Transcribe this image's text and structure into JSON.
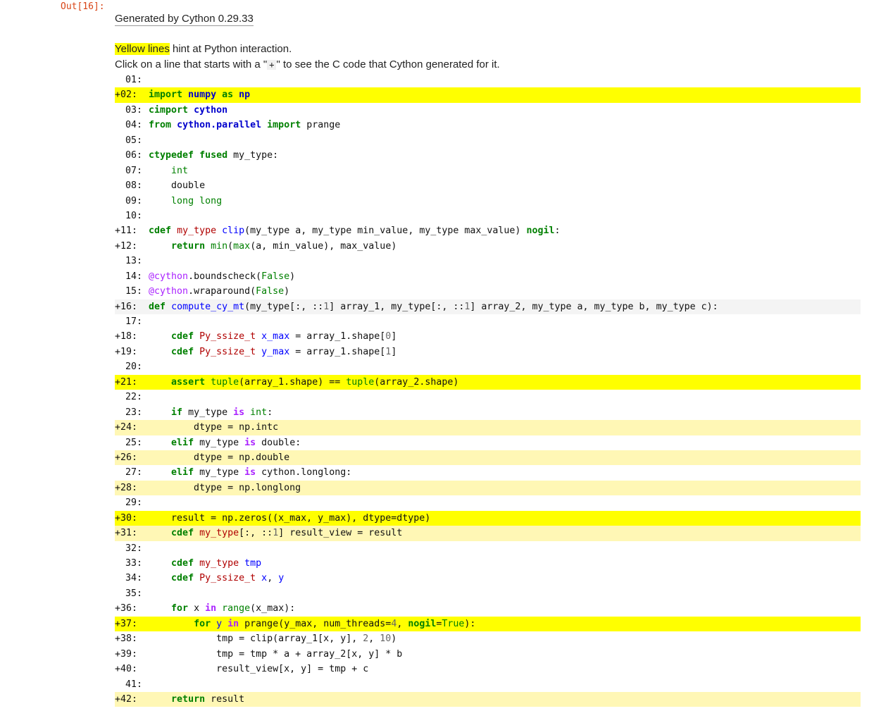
{
  "cell": {
    "prompt": "Out[16]:"
  },
  "report": {
    "generated_by": "Generated by Cython 0.29.33",
    "hint_yellow": "Yellow lines",
    "hint_rest": " hint at Python interaction.",
    "hint2_pre": "Click on a line that starts with a \"",
    "hint2_plus": "+",
    "hint2_post": "\" to see the C code that Cython generated for it."
  },
  "code_lines": [
    {
      "n": "01:",
      "plus": false,
      "hl": 0
    },
    {
      "n": "+02:",
      "plus": true,
      "hl": 2
    },
    {
      "n": "03:",
      "plus": false,
      "hl": 0
    },
    {
      "n": "04:",
      "plus": false,
      "hl": 0
    },
    {
      "n": "05:",
      "plus": false,
      "hl": 0
    },
    {
      "n": "06:",
      "plus": false,
      "hl": 0
    },
    {
      "n": "07:",
      "plus": false,
      "hl": 0
    },
    {
      "n": "08:",
      "plus": false,
      "hl": 0
    },
    {
      "n": "09:",
      "plus": false,
      "hl": 0
    },
    {
      "n": "10:",
      "plus": false,
      "hl": 0
    },
    {
      "n": "+11:",
      "plus": true,
      "hl": 0
    },
    {
      "n": "+12:",
      "plus": true,
      "hl": 0
    },
    {
      "n": "13:",
      "plus": false,
      "hl": 0
    },
    {
      "n": "14:",
      "plus": false,
      "hl": 0
    },
    {
      "n": "15:",
      "plus": false,
      "hl": 0
    },
    {
      "n": "+16:",
      "plus": true,
      "hl": 3
    },
    {
      "n": "17:",
      "plus": false,
      "hl": 0
    },
    {
      "n": "+18:",
      "plus": true,
      "hl": 0
    },
    {
      "n": "+19:",
      "plus": true,
      "hl": 0
    },
    {
      "n": "20:",
      "plus": false,
      "hl": 0
    },
    {
      "n": "+21:",
      "plus": true,
      "hl": 2
    },
    {
      "n": "22:",
      "plus": false,
      "hl": 0
    },
    {
      "n": "23:",
      "plus": false,
      "hl": 0
    },
    {
      "n": "+24:",
      "plus": true,
      "hl": 1
    },
    {
      "n": "25:",
      "plus": false,
      "hl": 0
    },
    {
      "n": "+26:",
      "plus": true,
      "hl": 1
    },
    {
      "n": "27:",
      "plus": false,
      "hl": 0
    },
    {
      "n": "+28:",
      "plus": true,
      "hl": 1
    },
    {
      "n": "29:",
      "plus": false,
      "hl": 0
    },
    {
      "n": "+30:",
      "plus": true,
      "hl": 2
    },
    {
      "n": "+31:",
      "plus": true,
      "hl": 1
    },
    {
      "n": "32:",
      "plus": false,
      "hl": 0
    },
    {
      "n": "33:",
      "plus": false,
      "hl": 0
    },
    {
      "n": "34:",
      "plus": false,
      "hl": 0
    },
    {
      "n": "35:",
      "plus": false,
      "hl": 0
    },
    {
      "n": "+36:",
      "plus": true,
      "hl": 0
    },
    {
      "n": "+37:",
      "plus": true,
      "hl": 2
    },
    {
      "n": "+38:",
      "plus": true,
      "hl": 0
    },
    {
      "n": "+39:",
      "plus": true,
      "hl": 0
    },
    {
      "n": "+40:",
      "plus": true,
      "hl": 0
    },
    {
      "n": "41:",
      "plus": false,
      "hl": 0
    },
    {
      "n": "+42:",
      "plus": true,
      "hl": 1
    }
  ],
  "code_tokens": [
    [],
    [
      [
        "kw",
        "import"
      ],
      [
        "t",
        " "
      ],
      [
        "mod",
        "numpy"
      ],
      [
        "t",
        " "
      ],
      [
        "kw",
        "as"
      ],
      [
        "t",
        " "
      ],
      [
        "mod",
        "np"
      ]
    ],
    [
      [
        "kw",
        "cimport"
      ],
      [
        "t",
        " "
      ],
      [
        "mod",
        "cython"
      ]
    ],
    [
      [
        "kw",
        "from"
      ],
      [
        "t",
        " "
      ],
      [
        "mod",
        "cython.parallel"
      ],
      [
        "t",
        " "
      ],
      [
        "kw",
        "import"
      ],
      [
        "t",
        " prange"
      ]
    ],
    [],
    [
      [
        "kw",
        "ctypedef"
      ],
      [
        "t",
        " "
      ],
      [
        "kw",
        "fused"
      ],
      [
        "t",
        " my_type:"
      ]
    ],
    [
      [
        "t",
        "    "
      ],
      [
        "kc",
        "int"
      ]
    ],
    [
      [
        "t",
        "    double"
      ]
    ],
    [
      [
        "t",
        "    "
      ],
      [
        "kc",
        "long long"
      ]
    ],
    [],
    [
      [
        "kw",
        "cdef"
      ],
      [
        "t",
        " "
      ],
      [
        "ty",
        "my_type"
      ],
      [
        "t",
        " "
      ],
      [
        "fn",
        "clip"
      ],
      [
        "t",
        "(my_type a, my_type min_value, my_type max_value) "
      ],
      [
        "kw",
        "nogil"
      ],
      [
        "t",
        ":"
      ]
    ],
    [
      [
        "t",
        "    "
      ],
      [
        "kw",
        "return"
      ],
      [
        "t",
        " "
      ],
      [
        "bi",
        "min"
      ],
      [
        "t",
        "("
      ],
      [
        "bi",
        "max"
      ],
      [
        "t",
        "(a, min_value), max_value)"
      ]
    ],
    [],
    [
      [
        "dec",
        "@cython"
      ],
      [
        "t",
        ".boundscheck("
      ],
      [
        "kc",
        "False"
      ],
      [
        "t",
        ")"
      ]
    ],
    [
      [
        "dec",
        "@cython"
      ],
      [
        "t",
        ".wraparound("
      ],
      [
        "kc",
        "False"
      ],
      [
        "t",
        ")"
      ]
    ],
    [
      [
        "kw",
        "def"
      ],
      [
        "t",
        " "
      ],
      [
        "fn",
        "compute_cy_mt"
      ],
      [
        "t",
        "(my_type[:, ::"
      ],
      [
        "nm",
        "1"
      ],
      [
        "t",
        "] array_1, my_type[:, ::"
      ],
      [
        "nm",
        "1"
      ],
      [
        "t",
        "] array_2, my_type a, my_type b, my_type c):"
      ]
    ],
    [],
    [
      [
        "t",
        "    "
      ],
      [
        "kw",
        "cdef"
      ],
      [
        "t",
        " "
      ],
      [
        "ty",
        "Py_ssize_t"
      ],
      [
        "t",
        " "
      ],
      [
        "fn",
        "x_max"
      ],
      [
        "t",
        " = array_1.shape["
      ],
      [
        "nm",
        "0"
      ],
      [
        "t",
        "]"
      ]
    ],
    [
      [
        "t",
        "    "
      ],
      [
        "kw",
        "cdef"
      ],
      [
        "t",
        " "
      ],
      [
        "ty",
        "Py_ssize_t"
      ],
      [
        "t",
        " "
      ],
      [
        "fn",
        "y_max"
      ],
      [
        "t",
        " = array_1.shape["
      ],
      [
        "nm",
        "1"
      ],
      [
        "t",
        "]"
      ]
    ],
    [],
    [
      [
        "t",
        "    "
      ],
      [
        "kw",
        "assert"
      ],
      [
        "t",
        " "
      ],
      [
        "bi",
        "tuple"
      ],
      [
        "t",
        "(array_1.shape) == "
      ],
      [
        "bi",
        "tuple"
      ],
      [
        "t",
        "(array_2.shape)"
      ]
    ],
    [],
    [
      [
        "t",
        "    "
      ],
      [
        "kw",
        "if"
      ],
      [
        "t",
        " my_type "
      ],
      [
        "op",
        "is"
      ],
      [
        "t",
        " "
      ],
      [
        "kc",
        "int"
      ],
      [
        "t",
        ":"
      ]
    ],
    [
      [
        "t",
        "        dtype = np.intc"
      ]
    ],
    [
      [
        "t",
        "    "
      ],
      [
        "kw",
        "elif"
      ],
      [
        "t",
        " my_type "
      ],
      [
        "op",
        "is"
      ],
      [
        "t",
        " double:"
      ]
    ],
    [
      [
        "t",
        "        dtype = np.double"
      ]
    ],
    [
      [
        "t",
        "    "
      ],
      [
        "kw",
        "elif"
      ],
      [
        "t",
        " my_type "
      ],
      [
        "op",
        "is"
      ],
      [
        "t",
        " cython.longlong:"
      ]
    ],
    [
      [
        "t",
        "        dtype = np.longlong"
      ]
    ],
    [],
    [
      [
        "t",
        "    result = np.zeros((x_max, y_max), dtype=dtype)"
      ]
    ],
    [
      [
        "t",
        "    "
      ],
      [
        "kw",
        "cdef"
      ],
      [
        "t",
        " "
      ],
      [
        "ty",
        "my_type"
      ],
      [
        "t",
        "[:, ::"
      ],
      [
        "nm",
        "1"
      ],
      [
        "t",
        "] result_view = result"
      ]
    ],
    [],
    [
      [
        "t",
        "    "
      ],
      [
        "kw",
        "cdef"
      ],
      [
        "t",
        " "
      ],
      [
        "ty",
        "my_type"
      ],
      [
        "t",
        " "
      ],
      [
        "fn",
        "tmp"
      ]
    ],
    [
      [
        "t",
        "    "
      ],
      [
        "kw",
        "cdef"
      ],
      [
        "t",
        " "
      ],
      [
        "ty",
        "Py_ssize_t"
      ],
      [
        "t",
        " "
      ],
      [
        "fn",
        "x"
      ],
      [
        "t",
        ", "
      ],
      [
        "fn",
        "y"
      ]
    ],
    [],
    [
      [
        "t",
        "    "
      ],
      [
        "kw",
        "for"
      ],
      [
        "t",
        " x "
      ],
      [
        "op",
        "in"
      ],
      [
        "t",
        " "
      ],
      [
        "bi",
        "range"
      ],
      [
        "t",
        "(x_max):"
      ]
    ],
    [
      [
        "t",
        "        "
      ],
      [
        "kw",
        "for"
      ],
      [
        "t",
        " "
      ],
      [
        "fn",
        "y"
      ],
      [
        "t",
        " "
      ],
      [
        "op",
        "in"
      ],
      [
        "t",
        " prange(y_max, num_threads="
      ],
      [
        "nm",
        "4"
      ],
      [
        "t",
        ", "
      ],
      [
        "kw",
        "nogil"
      ],
      [
        "t",
        "="
      ],
      [
        "kc",
        "True"
      ],
      [
        "t",
        "):"
      ]
    ],
    [
      [
        "t",
        "            tmp = clip(array_1[x, y], "
      ],
      [
        "nm",
        "2"
      ],
      [
        "t",
        ", "
      ],
      [
        "nm",
        "10"
      ],
      [
        "t",
        ")"
      ]
    ],
    [
      [
        "t",
        "            tmp = tmp * a + array_2[x, y] * b"
      ]
    ],
    [
      [
        "t",
        "            result_view[x, y] = tmp + c"
      ]
    ],
    [],
    [
      [
        "t",
        "    "
      ],
      [
        "kw",
        "return"
      ],
      [
        "t",
        " result"
      ]
    ]
  ]
}
